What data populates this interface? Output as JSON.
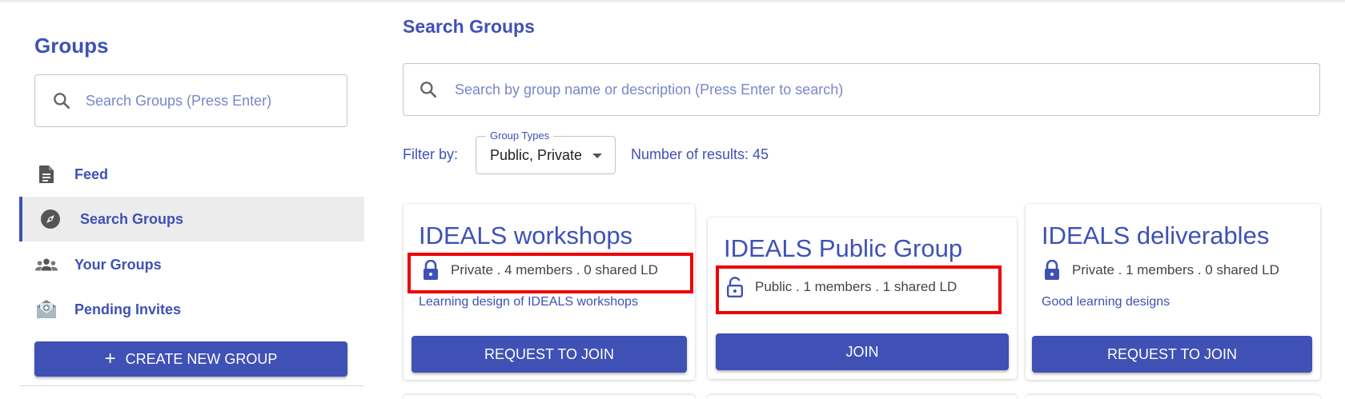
{
  "sidebar": {
    "title": "Groups",
    "search_placeholder": "Search Groups (Press Enter)",
    "items": [
      {
        "label": "Feed",
        "icon": "document-icon"
      },
      {
        "label": "Search Groups",
        "icon": "compass-icon",
        "active": true
      },
      {
        "label": "Your Groups",
        "icon": "group-icon"
      },
      {
        "label": "Pending Invites",
        "icon": "mail-invite-icon"
      }
    ],
    "create_button": "CREATE NEW GROUP"
  },
  "main": {
    "title": "Search Groups",
    "search_placeholder": "Search by group name or description (Press Enter to search)",
    "filter_label": "Filter by:",
    "group_types_label": "Group Types",
    "group_types_value": "Public, Private",
    "results": "Number of results: 45",
    "cards": [
      {
        "title": "IDEALS workshops",
        "meta": "Private . 4 members . 0 shared LD",
        "lock": "locked",
        "desc": "Learning design of IDEALS workshops",
        "button": "REQUEST TO JOIN"
      },
      {
        "title": "IDEALS Public Group",
        "meta": "Public . 1 members . 1 shared LD",
        "lock": "unlocked",
        "desc": "",
        "button": "JOIN"
      },
      {
        "title": "IDEALS deliverables",
        "meta": "Private . 1 members . 0 shared LD",
        "lock": "locked",
        "desc": "Good learning designs",
        "button": "REQUEST TO JOIN"
      }
    ]
  },
  "colors": {
    "primary": "#3f51b5",
    "highlight": "#ee0000",
    "active_bg": "#ececec"
  }
}
